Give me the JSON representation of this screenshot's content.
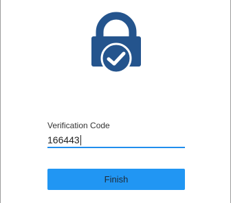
{
  "app": {
    "lock_icon": "lock-check-icon",
    "accent_color": "#2196f3",
    "icon_color": "#24548d"
  },
  "form": {
    "code_label": "Verification Code",
    "code_value": "166443",
    "finish_label": "Finish"
  }
}
